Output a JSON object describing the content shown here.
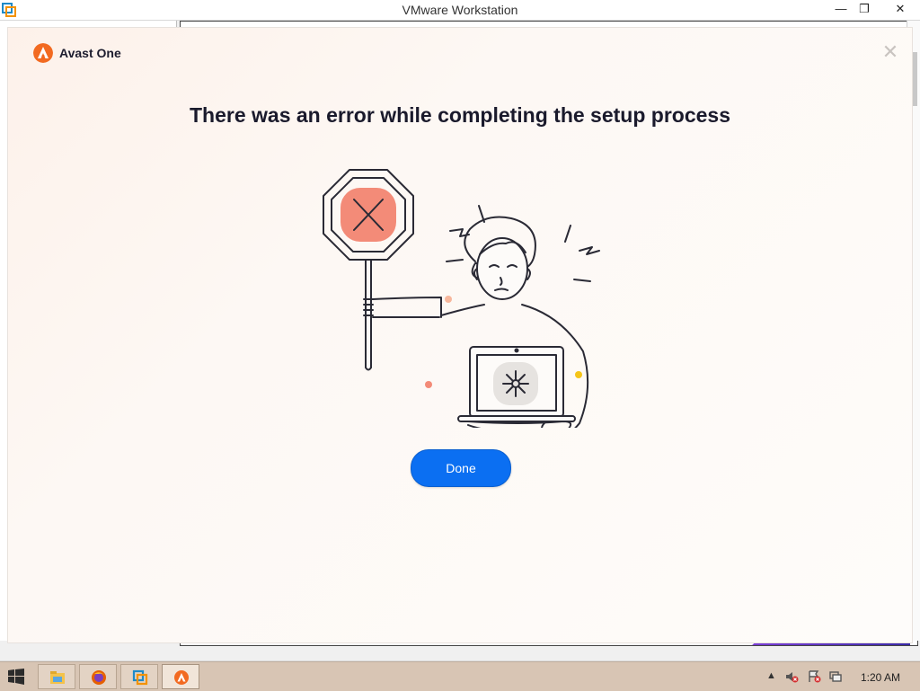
{
  "host": {
    "title": "VMware Workstation",
    "app_icon": "vmware-icon",
    "controls": {
      "minimize": "—",
      "restore": "❐",
      "close": "✕"
    }
  },
  "dialog": {
    "brand": "Avast One",
    "brand_color": "#f26a21",
    "close_symbol": "✕",
    "headline": "There was an error while completing the setup process",
    "done_label": "Done",
    "accent_color": "#0b6ff2"
  },
  "taskbar": {
    "items": [
      {
        "icon": "file-explorer-icon"
      },
      {
        "icon": "firefox-icon"
      },
      {
        "icon": "vmware-icon"
      },
      {
        "icon": "avast-icon"
      }
    ],
    "tray": {
      "arrow": "▲"
    },
    "clock": "1:20 AM"
  }
}
